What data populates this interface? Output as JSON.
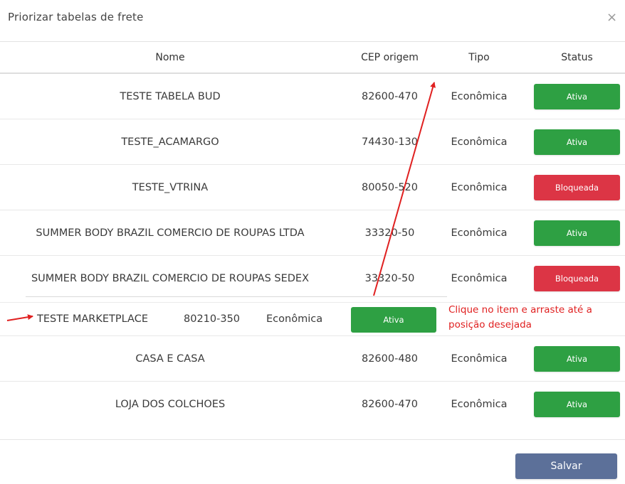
{
  "modal": {
    "title": "Priorizar tabelas de frete",
    "close_icon": "×"
  },
  "table": {
    "headers": {
      "nome": "Nome",
      "cep": "CEP origem",
      "tipo": "Tipo",
      "status": "Status"
    },
    "rows": [
      {
        "nome": "TESTE TABELA BUD",
        "cep": "82600-470",
        "tipo": "Econômica",
        "status": "Ativa",
        "status_type": "active"
      },
      {
        "nome": "TESTE_ACAMARGO",
        "cep": "74430-130",
        "tipo": "Econômica",
        "status": "Ativa",
        "status_type": "active"
      },
      {
        "nome": "TESTE_VTRINA",
        "cep": "80050-520",
        "tipo": "Econômica",
        "status": "Bloqueada",
        "status_type": "blocked"
      },
      {
        "nome": "SUMMER BODY BRAZIL COMERCIO DE ROUPAS LTDA",
        "cep": "33320-50",
        "tipo": "Econômica",
        "status": "Ativa",
        "status_type": "active"
      },
      {
        "nome": "SUMMER BODY BRAZIL COMERCIO DE ROUPAS SEDEX",
        "cep": "33320-50",
        "tipo": "Econômica",
        "status": "Bloqueada",
        "status_type": "blocked"
      },
      {
        "nome": "CASA E CASA",
        "cep": "82600-480",
        "tipo": "Econômica",
        "status": "Ativa",
        "status_type": "active"
      },
      {
        "nome": "LOJA DOS COLCHOES",
        "cep": "82600-470",
        "tipo": "Econômica",
        "status": "Ativa",
        "status_type": "active"
      }
    ]
  },
  "dragging_row": {
    "nome": "TESTE MARKETPLACE",
    "cep": "80210-350",
    "tipo": "Econômica",
    "status": "Ativa"
  },
  "hint": {
    "line1": "Clique no item e arraste até a",
    "line2": "posição desejada"
  },
  "footer": {
    "save_label": "Salvar"
  },
  "colors": {
    "active": "#2ea043",
    "blocked": "#dc3545",
    "save": "#5c7099",
    "annotation": "#e02020"
  }
}
